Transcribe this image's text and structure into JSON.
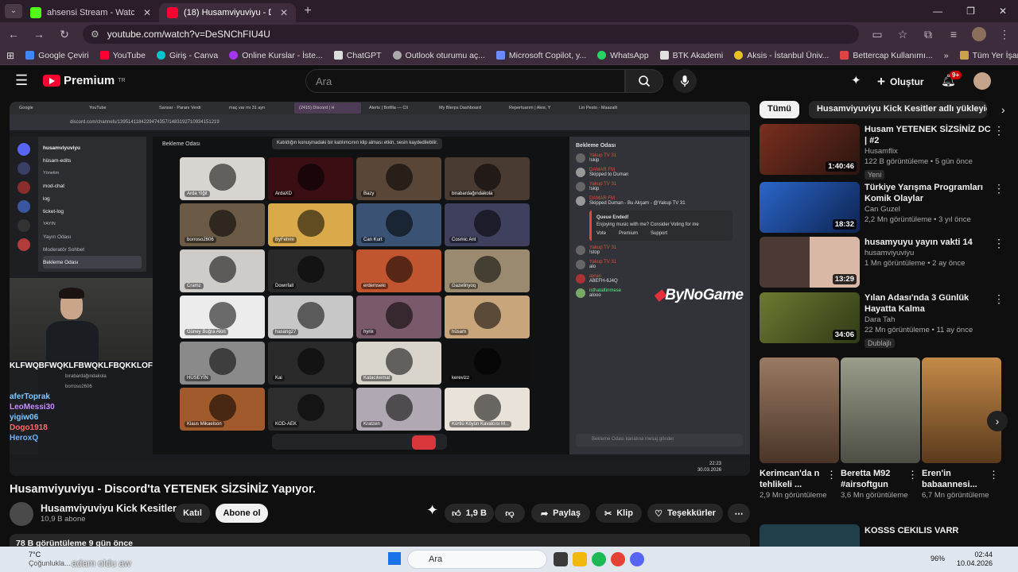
{
  "browser": {
    "tabs": [
      {
        "label": "ahsensi Stream - Watch Live on",
        "color": "#53fc18"
      },
      {
        "label": "(18) Husamviyuviyu - Discord",
        "color": "#ff0033"
      }
    ],
    "new_tab": "+",
    "url": "youtube.com/watch?v=DeSNChFIU4U",
    "bookmarks": [
      {
        "label": "Google Çeviri",
        "color": "#4285f4"
      },
      {
        "label": "YouTube",
        "color": "#ff0033"
      },
      {
        "label": "Giriş - Canva",
        "color": "#00c4cc"
      },
      {
        "label": "Online Kurslar - İste...",
        "color": "#a435f0"
      },
      {
        "label": "ChatGPT",
        "color": "#dddddd"
      },
      {
        "label": "Outlook oturumu aç...",
        "color": "#aaaaaa"
      },
      {
        "label": "Microsoft Copilot, y...",
        "color": "#6b8cff"
      },
      {
        "label": "WhatsApp",
        "color": "#25d366"
      },
      {
        "label": "BTK Akademi",
        "color": "#e0e0e0"
      },
      {
        "label": "Aksis - İstanbul Üniv...",
        "color": "#e6c229"
      },
      {
        "label": "Bettercap Kullanımı...",
        "color": "#d44"
      }
    ],
    "all_bookmarks": "Tüm Yer İşaretleri"
  },
  "youtube": {
    "logo_text": "Premium",
    "logo_region": "TR",
    "search_placeholder": "Ara",
    "create_label": "Oluştur",
    "notif_count": "9+"
  },
  "video": {
    "title": "Husamviyuviyu - Discord'ta YETENEK SİZSİNİZ Yapıyor.",
    "channel": "Husamviyuviyu Kick Kesitler",
    "subscribers": "10,9 B abone",
    "join_label": "Katıl",
    "subscribe_label": "Abone ol",
    "likes": "1,9 B",
    "share_label": "Paylaş",
    "clip_label": "Klip",
    "thanks_label": "Teşekkürler",
    "views_line": "78 B görüntüleme  9 gün önce"
  },
  "embedded": {
    "inner_tabs": [
      "Google",
      "YouTube",
      "Sansar - Paranı Verdi",
      "maç var mı 31 ayrı",
      "(2415) Discord | H",
      "Alerts | Botfila — Cli",
      "My Blerps Dashboard",
      "Repertuarım | Akor, Y",
      "Lin Pesto - Maazalli"
    ],
    "inner_url": "discord.com/channels/1395141184229474357/1483192710934151219",
    "server_name": "husamviyuviyu",
    "channels": [
      "hüsam-edits",
      "Yönetim",
      "mod-chat",
      "log",
      "ticket-log",
      "YAYIN",
      "Yayın Odası",
      "Moderatör Sohbet",
      "Bekleme Odası"
    ],
    "stage_title": "Bekleme Odası",
    "stage_note": "Katıldığın konuşmadaki bir katılımcının klip alması etkin, sesin kaydedilebilir.",
    "participants": [
      {
        "name": "Arda Yiğit",
        "bg": "#d8d4cf"
      },
      {
        "name": "ArdaXD",
        "bg": "#3a0e12"
      },
      {
        "name": "Bazy",
        "bg": "#5a4636"
      },
      {
        "name": "birabardağındakola",
        "bg": "#4a3b32"
      },
      {
        "name": "borroso2606",
        "bg": "#6b5a45"
      },
      {
        "name": "ByFehmi",
        "bg": "#d9a94a"
      },
      {
        "name": "Can Kurt",
        "bg": "#3a5374"
      },
      {
        "name": "Cosmic Ant",
        "bg": "#3f3f5e"
      },
      {
        "name": "Cramz",
        "bg": "#cfcbc8"
      },
      {
        "name": "Downfall",
        "bg": "#2a2a2a"
      },
      {
        "name": "erdemseki",
        "bg": "#c0552f"
      },
      {
        "name": "Gazelinyoq",
        "bg": "#9a8a70"
      },
      {
        "name": "Güney Buğra Akın",
        "bg": "#ececec"
      },
      {
        "name": "hasang27",
        "bg": "#c7c7c7"
      },
      {
        "name": "hyrix",
        "bg": "#7a5a6a"
      },
      {
        "name": "hüsam",
        "bg": "#c9a57c"
      },
      {
        "name": "HÜSEYİN",
        "bg": "#8a8a8a"
      },
      {
        "name": "Kai",
        "bg": "#2a2a2a"
      },
      {
        "name": "Katacıkemal",
        "bg": "#d9d4cc"
      },
      {
        "name": "kerevizz",
        "bg": "#111111"
      },
      {
        "name": "Klaus Mikaelson",
        "bg": "#a05a2c"
      },
      {
        "name": "KOD-AEK",
        "bg": "#2d2d2d"
      },
      {
        "name": "Kratzen",
        "bg": "#b0a8b2"
      },
      {
        "name": "Kürtlü Köyün Kavalcısı M...",
        "bg": "#e8e2d8"
      }
    ],
    "chat_header": "Bekleme Odası",
    "chat_messages": [
      {
        "user": "Yakup TV 31",
        "text": "!skip",
        "color": "#e74c3c"
      },
      {
        "user": "DAMAR FM",
        "text": "Skipped to Duman",
        "color": "#e74c3c"
      },
      {
        "user": "Yakup TV 31",
        "text": "!skip",
        "color": "#e74c3c"
      },
      {
        "user": "DAMAR FM",
        "text": "Skipped Duman - Bu Akşam - @Yakup TV 31",
        "color": "#e74c3c"
      },
      {
        "user": "Yakup TV 31",
        "text": "!stop",
        "color": "#e74c3c"
      },
      {
        "user": "Yakup TV 31",
        "text": "alo",
        "color": "#e74c3c"
      },
      {
        "user": "ayran",
        "text": "A8EFH-6J4Q",
        "color": "#e74c3c"
      },
      {
        "user": "isthataltinmese",
        "text": "alooo",
        "color": "#57f287"
      }
    ],
    "embed_title": "Queue Ended!",
    "embed_text": "Enjoying music with me? Consider Voting for me",
    "embed_buttons": [
      "Vote",
      "Premium",
      "Support"
    ],
    "chat_placeholder": "Bekleme Odası kanalına mesaj gönder",
    "overlay_chat": [
      "KLFWQBFWQKLFBWQKLFBQKKLOF",
      "bırabardağındakola",
      "borroso2606",
      "aferToprak",
      "LeoMessi30",
      "yigiw06",
      "Dogo1918",
      "HeroxQ"
    ],
    "inner_clock": "22:23",
    "inner_date": "30.03.2026",
    "sponsor": "ByNoGame"
  },
  "sidebar": {
    "chips": [
      "Tümü",
      "Husamviyuviyu Kick Kesitler adlı yükleyici"
    ],
    "recs": [
      {
        "title": "Husam YETENEK SİZSİNİZ DC | #2",
        "channel": "Husamflix",
        "meta": "122 B görüntüleme • 5 gün önce",
        "duration": "1:40:46",
        "badge": "Yeni",
        "thumb": "#6b2a1d"
      },
      {
        "title": "Türkiye Yarışma Programları Komik Olaylar",
        "channel": "Can Guzel",
        "meta": "2,2 Mn görüntüleme • 3 yıl önce",
        "duration": "18:32",
        "badge": "",
        "thumb": "#1e4fa3"
      },
      {
        "title": "husamyuyu yayın vakti 14",
        "channel": "husamviyuviyu",
        "meta": "1 Mn görüntüleme • 2 ay önce",
        "duration": "13:29",
        "badge": "",
        "thumb": "#4b3a33"
      },
      {
        "title": "Yılan Adası'nda 3 Günlük Hayatta Kalma",
        "channel": "Dara Tah",
        "meta": "22 Mn görüntüleme • 11 ay önce",
        "duration": "34:06",
        "badge": "Dublajlı",
        "thumb": "#5b6a2a"
      }
    ],
    "shorts": [
      {
        "title": "Kerimcan'da n tehlikeli ...",
        "views": "2,9 Mn görüntüleme",
        "thumb": "#8a6a55"
      },
      {
        "title": "Beretta M92 #airsoftgun",
        "views": "3,6 Mn görüntüleme",
        "thumb": "#7a7d70"
      },
      {
        "title": "Eren'in babaannesi...",
        "views": "6,7 Mn görüntüleme",
        "thumb": "#a8743a"
      }
    ],
    "next_title": "KOSSS CEKILIS VARR"
  },
  "taskbar": {
    "weather_temp": "7°C",
    "weather_text": "Çoğunlukla...",
    "search_label": "Ara",
    "battery": "96%",
    "time": "02:44",
    "date": "10.04.2026"
  },
  "overlay_caption": "adam oldu aw"
}
